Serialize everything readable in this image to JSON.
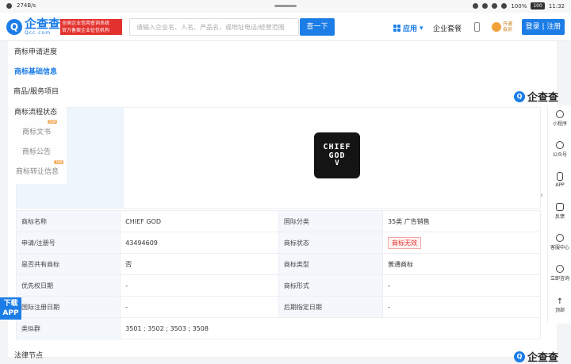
{
  "status_bar": {
    "speed": "274B/s",
    "battery_pct": "100%",
    "battery_badge": "100",
    "time": "11:32"
  },
  "header": {
    "logo_cn": "企查查",
    "logo_en": "Qcc.com",
    "badge_line1": "全国企业信用查询系统",
    "badge_line2": "官方备案企业征信机构",
    "search_placeholder": "请输入企业名、人名、产品名，或地址电话/经营范围",
    "search_button": "查一下",
    "apps_label": "应用",
    "combo_label": "企业套餐",
    "vip_line1": "开通",
    "vip_line2": "会员",
    "login_label": "登录 | 注册"
  },
  "left_nav": {
    "items": [
      {
        "label": "商标申请进度"
      },
      {
        "label": "商标基础信息"
      },
      {
        "label": "商品/服务项目"
      },
      {
        "label": "商标流程状态"
      },
      {
        "label": "商标文书"
      },
      {
        "label": "商标公告"
      },
      {
        "label": "商标转让信息"
      }
    ],
    "top_tag": "TOP"
  },
  "brand_logo": {
    "text": "企查查"
  },
  "trademark": {
    "image_line1": "CHIEF",
    "image_line2": "GOD",
    "image_mark": "V"
  },
  "info_table": {
    "rows": [
      {
        "k1": "商标名称",
        "v1": "CHIEF GOD",
        "k2": "国际分类",
        "v2": "35类 广告销售"
      },
      {
        "k1": "申请/注册号",
        "v1": "43494609",
        "k2": "商标状态",
        "v2": "商标无效"
      },
      {
        "k1": "是否共有商标",
        "v1": "否",
        "k2": "商标类型",
        "v2": "普通商标"
      },
      {
        "k1": "优先权日期",
        "v1": "-",
        "k2": "商标形式",
        "v2": "-"
      },
      {
        "k1": "国际注册日期",
        "v1": "-",
        "k2": "后期指定日期",
        "v2": "-"
      }
    ],
    "similar_group_label": "类似群",
    "similar_group_value": "3501 ; 3502 ; 3503 ; 3508"
  },
  "download_app": {
    "line1": "下载",
    "line2": "APP"
  },
  "next_section": {
    "title": "法律节点"
  },
  "right_bar": {
    "items": [
      {
        "label": "小程序"
      },
      {
        "label": "公众号"
      },
      {
        "label": "APP"
      },
      {
        "label": "反馈"
      },
      {
        "label": "客服中心"
      },
      {
        "label": "立即咨询"
      },
      {
        "label": "顶部"
      }
    ]
  },
  "colors": {
    "brand_blue": "#1c7de6",
    "badge_red": "#e3312d",
    "status_red": "#e3312d"
  }
}
